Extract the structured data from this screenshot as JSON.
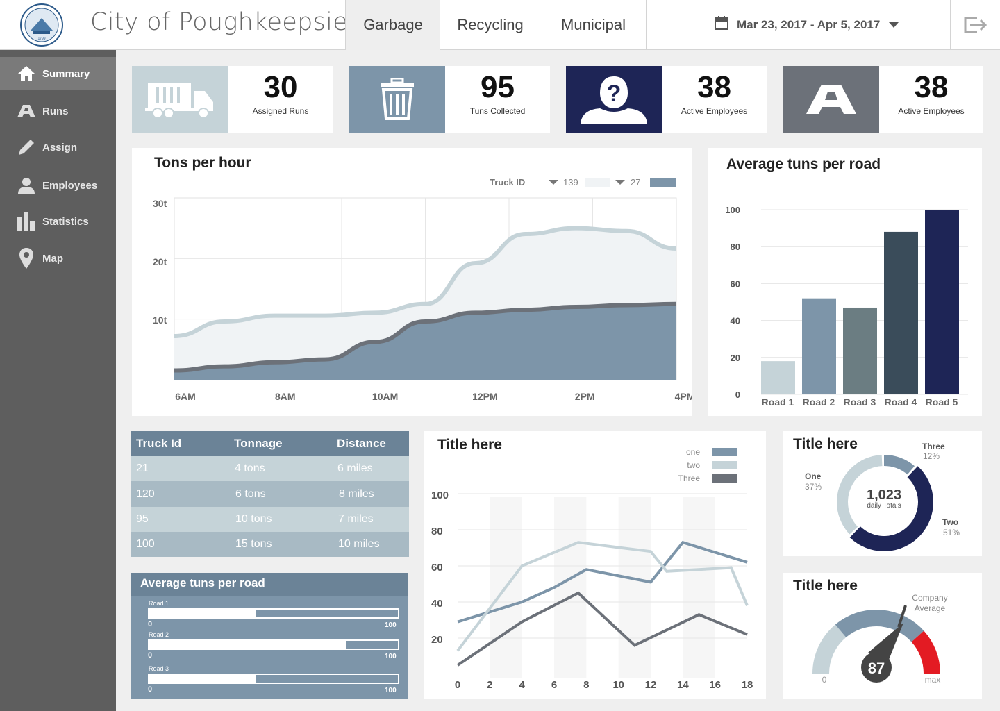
{
  "header": {
    "city_name": "City of Poughkeepsie",
    "tabs": [
      {
        "label": "Garbage",
        "active": true
      },
      {
        "label": "Recycling",
        "active": false
      },
      {
        "label": "Municipal",
        "active": false
      }
    ],
    "date_range": "Mar 23, 2017 - Apr 5, 2017",
    "logo_year": "1799"
  },
  "sidebar": {
    "items": [
      {
        "label": "Summary",
        "icon": "home-icon",
        "active": true
      },
      {
        "label": "Runs",
        "icon": "road-icon",
        "active": false
      },
      {
        "label": "Assign",
        "icon": "pencil-icon",
        "active": false
      },
      {
        "label": "Employees",
        "icon": "person-icon",
        "active": false
      },
      {
        "label": "Statistics",
        "icon": "bar-chart-icon",
        "active": false
      },
      {
        "label": "Map",
        "icon": "map-pin-icon",
        "active": false
      }
    ]
  },
  "stats": [
    {
      "value": "30",
      "label": "Assigned Runs",
      "icon": "garbage-truck-icon",
      "color": "#c5d3d8"
    },
    {
      "value": "95",
      "label": "Tuns Collected",
      "icon": "trash-can-icon",
      "color": "#7d95a9"
    },
    {
      "value": "38",
      "label": "Active Employees",
      "icon": "unknown-person-icon",
      "color": "#1e2556"
    },
    {
      "value": "38",
      "label": "Active Employees",
      "icon": "road-icon",
      "color": "#6c7179"
    }
  ],
  "colors": {
    "light": "#c5d3d8",
    "mid": "#7d95a9",
    "navy": "#1e2556",
    "grey": "#6c7179",
    "teal_grey": "#6b7d82",
    "dark_slate": "#3a4c5a",
    "red": "#e31b23"
  },
  "charts": {
    "tons_per_hour": {
      "title": "Tons per hour",
      "legend_title": "Truck ID",
      "x_labels": [
        "6AM",
        "8AM",
        "10AM",
        "12PM",
        "2PM",
        "4PM"
      ],
      "y_labels": [
        "30t",
        "20t",
        "10t"
      ]
    },
    "avg_per_road": {
      "title": "Average tuns per road"
    },
    "line": {
      "title": "Title here"
    },
    "donut": {
      "title": "Title here"
    },
    "gauge": {
      "title": "Title here"
    }
  },
  "chart_data": [
    {
      "type": "area",
      "title": "Tons per hour",
      "x_categories": [
        "6AM",
        "8AM",
        "10AM",
        "12PM",
        "2PM",
        "4PM"
      ],
      "x": [
        6,
        7,
        8,
        9,
        10,
        11,
        12,
        13,
        14,
        15,
        16
      ],
      "ylim": [
        0,
        30
      ],
      "y_ticks": [
        10,
        20,
        30
      ],
      "legend_title": "Truck ID",
      "series": [
        {
          "name": "139",
          "color": "#f0f3f5",
          "line_color": "#c5d3d8",
          "values": [
            7.5,
            10,
            11,
            11,
            11.5,
            13,
            20,
            25,
            26,
            25.5,
            22.5
          ]
        },
        {
          "name": "27",
          "color": "#7d95a9",
          "line_color": "#6c7179",
          "values": [
            1.6,
            2.3,
            3,
            3.5,
            6.5,
            10,
            11.5,
            12,
            12.5,
            12.8,
            13
          ]
        }
      ]
    },
    {
      "type": "bar",
      "title": "Average tuns per road",
      "categories": [
        "Road 1",
        "Road 2",
        "Road 3",
        "Road 4",
        "Road 5"
      ],
      "values": [
        18,
        52,
        47,
        88,
        100
      ],
      "colors": [
        "#c5d3d8",
        "#7d95a9",
        "#6b7d82",
        "#3a4c5a",
        "#1e2556"
      ],
      "ylim": [
        0,
        100
      ],
      "y_ticks": [
        0,
        20,
        40,
        60,
        80,
        100
      ]
    },
    {
      "type": "line",
      "title": "Title here",
      "x": [
        0,
        2,
        4,
        6,
        8,
        10,
        12,
        14,
        16,
        18
      ],
      "ylim": [
        0,
        100
      ],
      "y_ticks": [
        20,
        40,
        60,
        80,
        100
      ],
      "series": [
        {
          "name": "one",
          "color": "#7d95a9",
          "points": [
            [
              0,
              29
            ],
            [
              4,
              40
            ],
            [
              6,
              48
            ],
            [
              8,
              58
            ],
            [
              12,
              51
            ],
            [
              14,
              73
            ],
            [
              18,
              62
            ]
          ]
        },
        {
          "name": "two",
          "color": "#c5d3d8",
          "points": [
            [
              0,
              13
            ],
            [
              4,
              60
            ],
            [
              7.5,
              73
            ],
            [
              12,
              68
            ],
            [
              13,
              57
            ],
            [
              17,
              59
            ],
            [
              18,
              38
            ]
          ]
        },
        {
          "name": "Three",
          "color": "#6c7179",
          "points": [
            [
              0,
              5
            ],
            [
              4,
              29
            ],
            [
              7.5,
              45
            ],
            [
              11,
              16
            ],
            [
              15,
              33
            ],
            [
              18,
              22
            ]
          ]
        }
      ]
    },
    {
      "type": "pie",
      "title": "Title here",
      "center_value": "1,023",
      "center_label": "daily Totals",
      "slices": [
        {
          "name": "Three",
          "value": 12,
          "label": "12%",
          "color": "#7d95a9"
        },
        {
          "name": "Two",
          "value": 51,
          "label": "51%",
          "color": "#1e2556"
        },
        {
          "name": "One",
          "value": 37,
          "label": "37%",
          "color": "#c5d3d8"
        }
      ]
    },
    {
      "type": "gauge",
      "title": "Title here",
      "value": 87,
      "min_label": "0",
      "max_label": "max",
      "marker_label": "Company Average"
    }
  ],
  "table": {
    "headers": [
      "Truck Id",
      "Tonnage",
      "Distance"
    ],
    "rows": [
      [
        "21",
        "4 tons",
        "6 miles"
      ],
      [
        "120",
        "6 tons",
        "8 miles"
      ],
      [
        "95",
        "10 tons",
        "7 miles"
      ],
      [
        "100",
        "15 tons",
        "10 miles"
      ]
    ]
  },
  "avg_bars": {
    "title": "Average tuns per road",
    "items": [
      {
        "label": "Road 1",
        "min": "0",
        "max": "100",
        "value": 43
      },
      {
        "label": "Road 2",
        "min": "0",
        "max": "100",
        "value": 79
      },
      {
        "label": "Road 3",
        "min": "0",
        "max": "100",
        "value": 43
      }
    ]
  }
}
